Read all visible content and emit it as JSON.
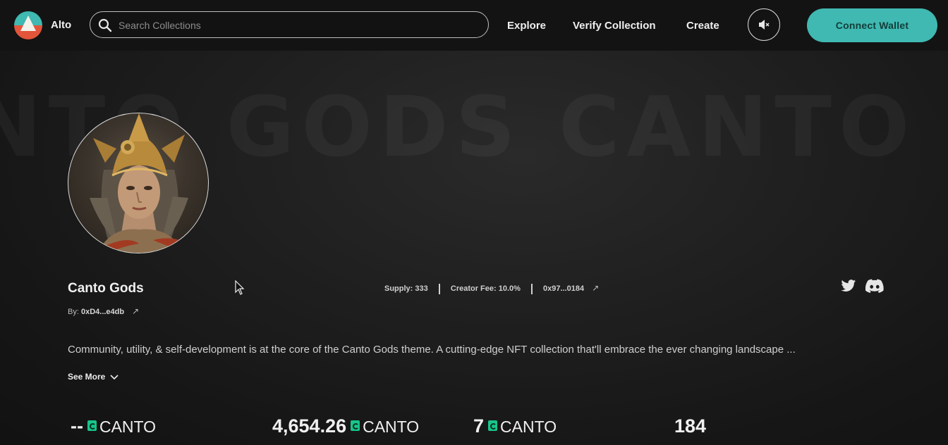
{
  "header": {
    "brand": "Alto",
    "search_placeholder": "Search Collections",
    "nav": [
      "Explore",
      "Verify Collection",
      "Create"
    ],
    "connect_label": "Connect Wallet"
  },
  "banner": {
    "watermark": "NTO GODS  CANTO G"
  },
  "collection": {
    "name": "Canto Gods",
    "creator_prefix": "By:",
    "creator_address": "0xD4...e4db",
    "supply": "Supply: 333",
    "creator_fee": "Creator Fee: 10.0%",
    "contract": "0x97...0184",
    "description": "Community, utility, & self-development is at the core of the Canto Gods theme. A cutting-edge NFT collection that'll embrace the ever changing landscape ...",
    "see_more": "See More"
  },
  "metrics": [
    {
      "value": "--",
      "unit": "CANTO"
    },
    {
      "value": "4,654.26",
      "unit": "CANTO"
    },
    {
      "value": "7",
      "unit": "CANTO"
    },
    {
      "value": "184",
      "unit": ""
    }
  ],
  "colors": {
    "accent": "#3fb9b1",
    "logo_bottom": "#e2553b",
    "canto_green": "#17c58a",
    "background": "#1a1a1a"
  },
  "icons": [
    "logo-icon",
    "search-icon",
    "mute-icon",
    "external-link-icon",
    "twitter-icon",
    "discord-icon",
    "chevron-down-icon",
    "canto-coin-icon",
    "cursor-icon"
  ]
}
